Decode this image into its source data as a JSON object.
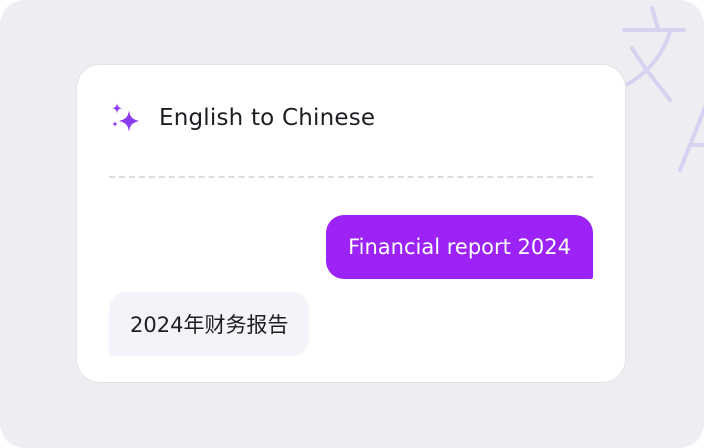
{
  "header": {
    "title": "English to Chinese",
    "icon": "sparkle-icon"
  },
  "messages": [
    {
      "role": "source",
      "text": "Financial report 2024"
    },
    {
      "role": "translation",
      "text": "2024年财务报告"
    }
  ],
  "colors": {
    "accent": "#9c22f5",
    "icon": "#8b3cf0",
    "frame_background": "#eeeef2",
    "card_background": "#ffffff",
    "translation_bubble": "#f4f3f9"
  }
}
